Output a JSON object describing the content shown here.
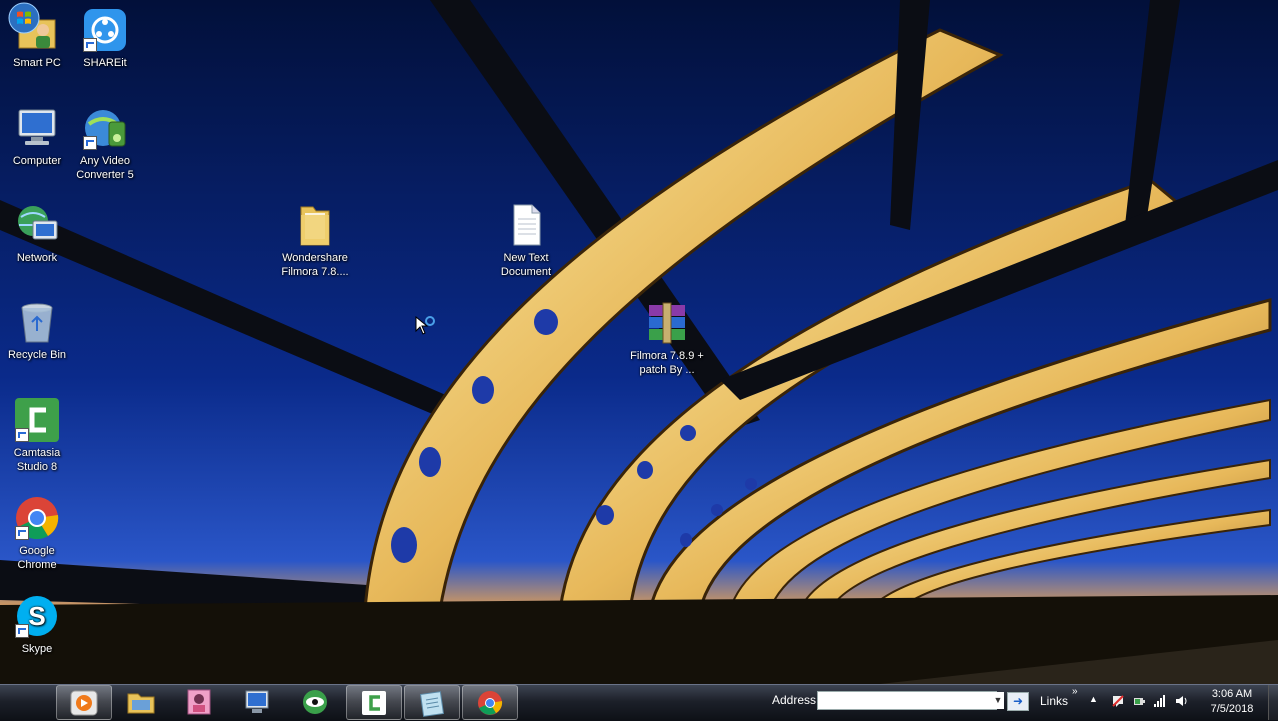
{
  "desktop": {
    "icons": [
      {
        "id": "smart-pc",
        "label": "Smart PC"
      },
      {
        "id": "shareit",
        "label": "SHAREit"
      },
      {
        "id": "computer",
        "label": "Computer"
      },
      {
        "id": "any-video-converter",
        "label": "Any Video Converter 5"
      },
      {
        "id": "network",
        "label": "Network"
      },
      {
        "id": "recycle-bin",
        "label": "Recycle Bin"
      },
      {
        "id": "camtasia",
        "label": "Camtasia Studio 8"
      },
      {
        "id": "google-chrome",
        "label": "Google Chrome"
      },
      {
        "id": "skype",
        "label": "Skype"
      },
      {
        "id": "wondershare-folder",
        "label": "Wondershare Filmora 7.8...."
      },
      {
        "id": "new-text-document",
        "label": "New Text Document"
      },
      {
        "id": "filmora-rar",
        "label": "Filmora 7.8.9 + patch By ..."
      }
    ]
  },
  "taskbar": {
    "start_icon": "windows-orb-icon",
    "pinned": [
      {
        "id": "media-player",
        "icon": "media-player-icon"
      },
      {
        "id": "explorer",
        "icon": "folder-icon"
      },
      {
        "id": "photo-app",
        "icon": "photo-icon"
      },
      {
        "id": "system-app",
        "icon": "monitor-icon"
      },
      {
        "id": "eye-app",
        "icon": "eye-icon"
      },
      {
        "id": "camtasia",
        "icon": "camtasia-icon"
      },
      {
        "id": "notepad",
        "icon": "notepad-icon"
      },
      {
        "id": "chrome",
        "icon": "chrome-icon"
      }
    ],
    "address_label": "Address",
    "address_value": "",
    "links_label": "Links",
    "links_chevron": "»",
    "clock_time": "3:06 AM",
    "clock_date": "7/5/2018"
  }
}
